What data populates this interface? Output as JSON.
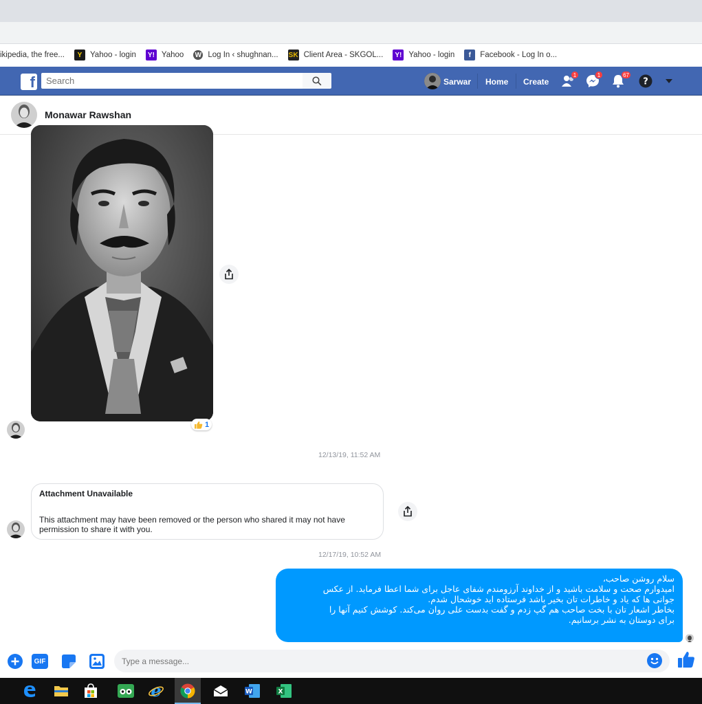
{
  "bookmarks": [
    {
      "label": "ikipedia, the free...",
      "icon": "wikipedia-icon"
    },
    {
      "label": "Yahoo - login",
      "icon": "yahoo-icon"
    },
    {
      "label": "Yahoo",
      "icon": "yahoo-icon"
    },
    {
      "label": "Log In ‹ shughnan...",
      "icon": "wordpress-icon"
    },
    {
      "label": "Client Area - SKGOL...",
      "icon": "sk-icon"
    },
    {
      "label": "Yahoo - login",
      "icon": "yahoo-icon"
    },
    {
      "label": "Facebook - Log In o...",
      "icon": "facebook-icon"
    }
  ],
  "fb": {
    "logo": "f",
    "search_placeholder": "Search",
    "user": "Sarwar",
    "home": "Home",
    "create": "Create",
    "friend_badge": "1",
    "messenger_badge": "1",
    "notif_badge": "67"
  },
  "conversation": {
    "contact_name": "Monawar Rawshan",
    "reaction_count": "1",
    "timestamp_1": "12/13/19, 11:52 AM",
    "attachment_title": "Attachment Unavailable",
    "attachment_body": "This attachment may have been removed or the person who shared it may not have permission to share it with you.",
    "timestamp_2": "12/17/19, 10:52 AM",
    "outgoing_lines": [
      "سلام روشن صاحب،",
      "امیدوارم صحت و سلامت باشید و از خداوند آرزومندم شفای عاجل برای شما اعطا فرماید. از عکس",
      "جوانی ها که یاد و خاطرات تان بخیر باشد فرستاده اید خوشحال شدم.",
      "بخاطر اشعار تان با بخت صاحب هم گپ زدم و گفت بدست علی روان می‌کند. کوشش کنیم آنها را",
      "برای دوستان به نشر برسانیم."
    ]
  },
  "composer": {
    "placeholder": "Type a message...",
    "gif_label": "GIF"
  },
  "colors": {
    "fb_blue": "#4267b2",
    "messenger_blue": "#0099ff",
    "like_blue": "#1877f2"
  }
}
